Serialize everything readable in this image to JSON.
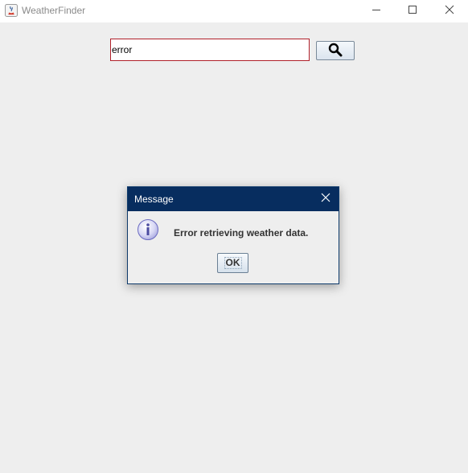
{
  "window": {
    "title": "WeatherFinder",
    "controls": {
      "minimize_icon": "minimize-icon",
      "maximize_icon": "maximize-icon",
      "close_icon": "close-icon"
    }
  },
  "search": {
    "value": "error",
    "button_icon": "search-icon",
    "border_color": "#b0202a"
  },
  "dialog": {
    "title": "Message",
    "message": "Error retrieving weather data.",
    "icon": "info-icon",
    "ok_label": "OK",
    "title_bar_color": "#072d5f"
  }
}
